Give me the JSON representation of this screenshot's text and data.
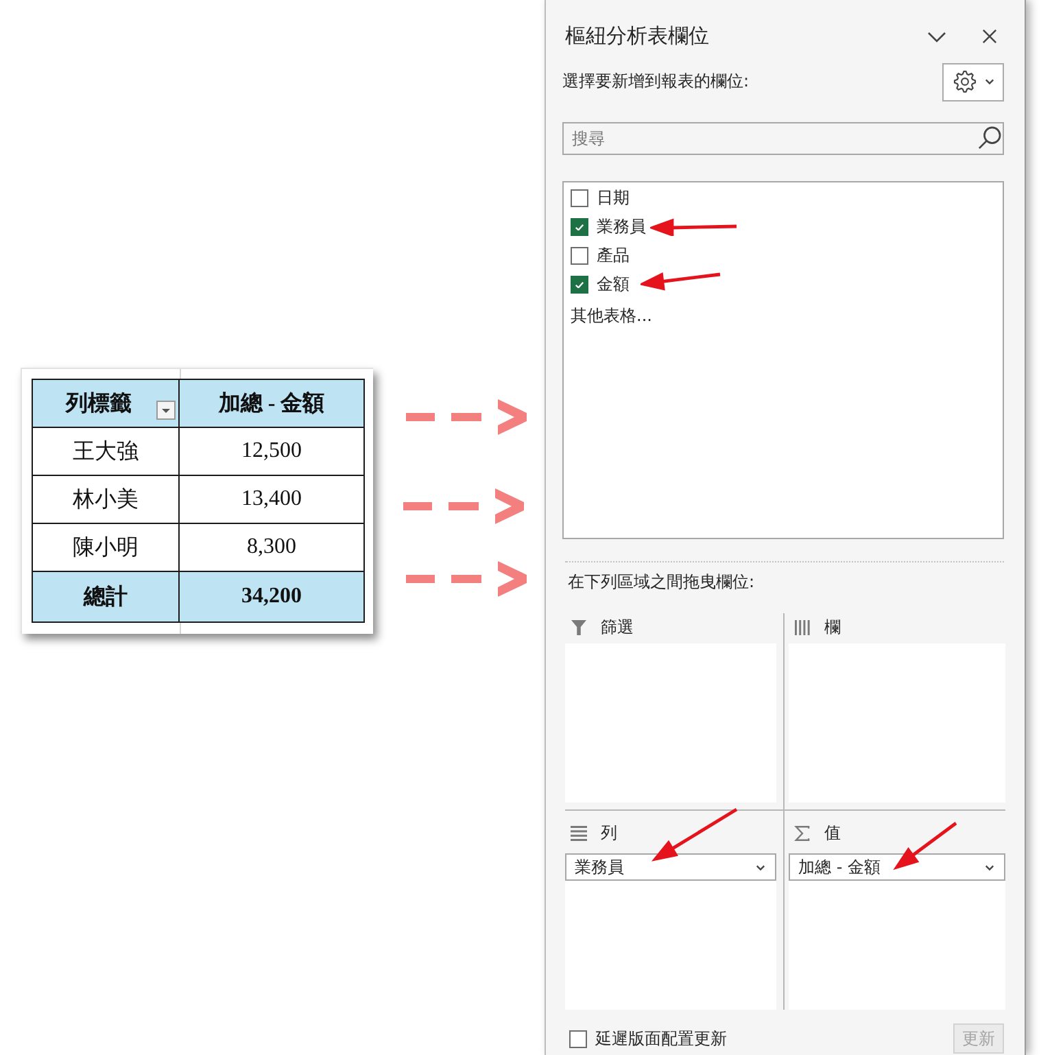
{
  "pivot_table": {
    "columns": [
      "列標籤",
      "加總 - 金額"
    ],
    "rows": [
      {
        "label": "王大強",
        "value": "12,500"
      },
      {
        "label": "林小美",
        "value": "13,400"
      },
      {
        "label": "陳小明",
        "value": "8,300"
      }
    ],
    "total": {
      "label": "總計",
      "value": "34,200"
    }
  },
  "field_pane": {
    "title": "樞紐分析表欄位",
    "choose_label": "選擇要新增到報表的欄位:",
    "search": {
      "placeholder": "搜尋"
    },
    "fields": [
      {
        "label": "日期",
        "checked": false
      },
      {
        "label": "業務員",
        "checked": true
      },
      {
        "label": "產品",
        "checked": false
      },
      {
        "label": "金額",
        "checked": true
      }
    ],
    "more_tables": "其他表格...",
    "drag_label": "在下列區域之間拖曳欄位:",
    "areas": [
      {
        "kind": "filters",
        "label": "篩選"
      },
      {
        "kind": "columns",
        "label": "欄"
      },
      {
        "kind": "rows",
        "label": "列",
        "items": [
          "業務員"
        ]
      },
      {
        "kind": "values",
        "label": "值",
        "items": [
          "加總 - 金額"
        ]
      }
    ],
    "defer_update": {
      "label": "延遲版面配置更新",
      "checked": false
    },
    "update_button": {
      "label": "更新",
      "disabled": true
    }
  }
}
